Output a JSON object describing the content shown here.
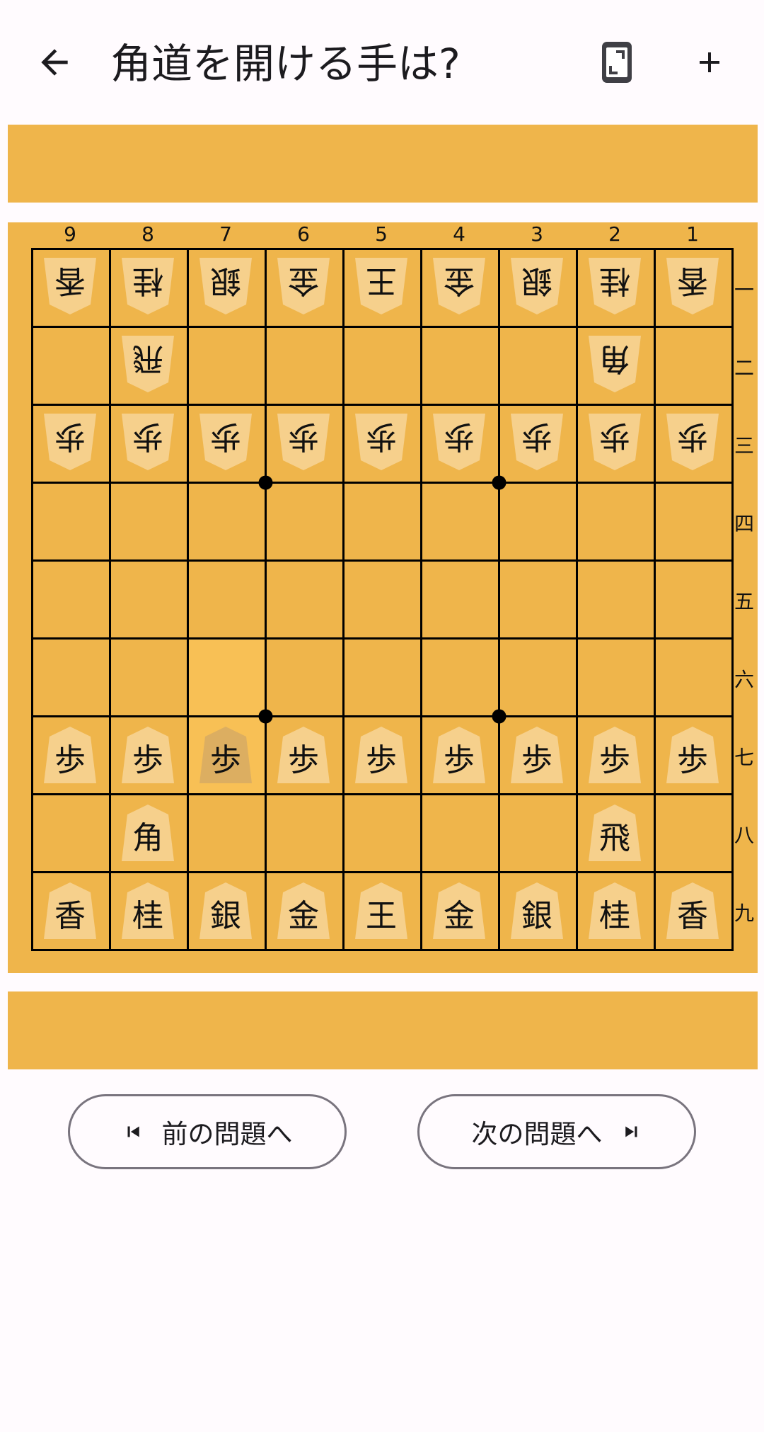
{
  "header": {
    "title": "角道を開ける手は?",
    "back_icon": "arrow-back-icon",
    "rotate_icon": "screen-rotation-icon",
    "add_icon": "plus-icon"
  },
  "colors": {
    "board": "#efb54b",
    "highlight": "#f8c055",
    "piece": "#f6d08c",
    "line": "#000000"
  },
  "board": {
    "file_labels": [
      "9",
      "8",
      "7",
      "6",
      "5",
      "4",
      "3",
      "2",
      "1"
    ],
    "rank_labels": [
      "一",
      "二",
      "三",
      "四",
      "五",
      "六",
      "七",
      "八",
      "九"
    ],
    "highlight_squares": [
      {
        "file": 7,
        "rank": 6
      },
      {
        "file": 7,
        "rank": 7
      }
    ],
    "pieces": [
      {
        "file": 9,
        "rank": 1,
        "kanji": "香",
        "owner": "gote"
      },
      {
        "file": 8,
        "rank": 1,
        "kanji": "桂",
        "owner": "gote"
      },
      {
        "file": 7,
        "rank": 1,
        "kanji": "銀",
        "owner": "gote"
      },
      {
        "file": 6,
        "rank": 1,
        "kanji": "金",
        "owner": "gote"
      },
      {
        "file": 5,
        "rank": 1,
        "kanji": "王",
        "owner": "gote"
      },
      {
        "file": 4,
        "rank": 1,
        "kanji": "金",
        "owner": "gote"
      },
      {
        "file": 3,
        "rank": 1,
        "kanji": "銀",
        "owner": "gote"
      },
      {
        "file": 2,
        "rank": 1,
        "kanji": "桂",
        "owner": "gote"
      },
      {
        "file": 1,
        "rank": 1,
        "kanji": "香",
        "owner": "gote"
      },
      {
        "file": 8,
        "rank": 2,
        "kanji": "飛",
        "owner": "gote"
      },
      {
        "file": 2,
        "rank": 2,
        "kanji": "角",
        "owner": "gote"
      },
      {
        "file": 9,
        "rank": 3,
        "kanji": "歩",
        "owner": "gote"
      },
      {
        "file": 8,
        "rank": 3,
        "kanji": "歩",
        "owner": "gote"
      },
      {
        "file": 7,
        "rank": 3,
        "kanji": "歩",
        "owner": "gote"
      },
      {
        "file": 6,
        "rank": 3,
        "kanji": "歩",
        "owner": "gote"
      },
      {
        "file": 5,
        "rank": 3,
        "kanji": "歩",
        "owner": "gote"
      },
      {
        "file": 4,
        "rank": 3,
        "kanji": "歩",
        "owner": "gote"
      },
      {
        "file": 3,
        "rank": 3,
        "kanji": "歩",
        "owner": "gote"
      },
      {
        "file": 2,
        "rank": 3,
        "kanji": "歩",
        "owner": "gote"
      },
      {
        "file": 1,
        "rank": 3,
        "kanji": "歩",
        "owner": "gote"
      },
      {
        "file": 9,
        "rank": 7,
        "kanji": "歩",
        "owner": "sente"
      },
      {
        "file": 8,
        "rank": 7,
        "kanji": "歩",
        "owner": "sente"
      },
      {
        "file": 7,
        "rank": 7,
        "kanji": "歩",
        "owner": "sente"
      },
      {
        "file": 6,
        "rank": 7,
        "kanji": "歩",
        "owner": "sente"
      },
      {
        "file": 5,
        "rank": 7,
        "kanji": "歩",
        "owner": "sente"
      },
      {
        "file": 4,
        "rank": 7,
        "kanji": "歩",
        "owner": "sente"
      },
      {
        "file": 3,
        "rank": 7,
        "kanji": "歩",
        "owner": "sente"
      },
      {
        "file": 2,
        "rank": 7,
        "kanji": "歩",
        "owner": "sente"
      },
      {
        "file": 1,
        "rank": 7,
        "kanji": "歩",
        "owner": "sente"
      },
      {
        "file": 8,
        "rank": 8,
        "kanji": "角",
        "owner": "sente"
      },
      {
        "file": 2,
        "rank": 8,
        "kanji": "飛",
        "owner": "sente"
      },
      {
        "file": 9,
        "rank": 9,
        "kanji": "香",
        "owner": "sente"
      },
      {
        "file": 8,
        "rank": 9,
        "kanji": "桂",
        "owner": "sente"
      },
      {
        "file": 7,
        "rank": 9,
        "kanji": "銀",
        "owner": "sente"
      },
      {
        "file": 6,
        "rank": 9,
        "kanji": "金",
        "owner": "sente"
      },
      {
        "file": 5,
        "rank": 9,
        "kanji": "王",
        "owner": "sente"
      },
      {
        "file": 4,
        "rank": 9,
        "kanji": "金",
        "owner": "sente"
      },
      {
        "file": 3,
        "rank": 9,
        "kanji": "銀",
        "owner": "sente"
      },
      {
        "file": 2,
        "rank": 9,
        "kanji": "桂",
        "owner": "sente"
      },
      {
        "file": 1,
        "rank": 9,
        "kanji": "香",
        "owner": "sente"
      }
    ]
  },
  "nav": {
    "prev_label": "前の問題へ",
    "next_label": "次の問題へ",
    "prev_icon": "skip-previous-icon",
    "next_icon": "skip-next-icon"
  }
}
